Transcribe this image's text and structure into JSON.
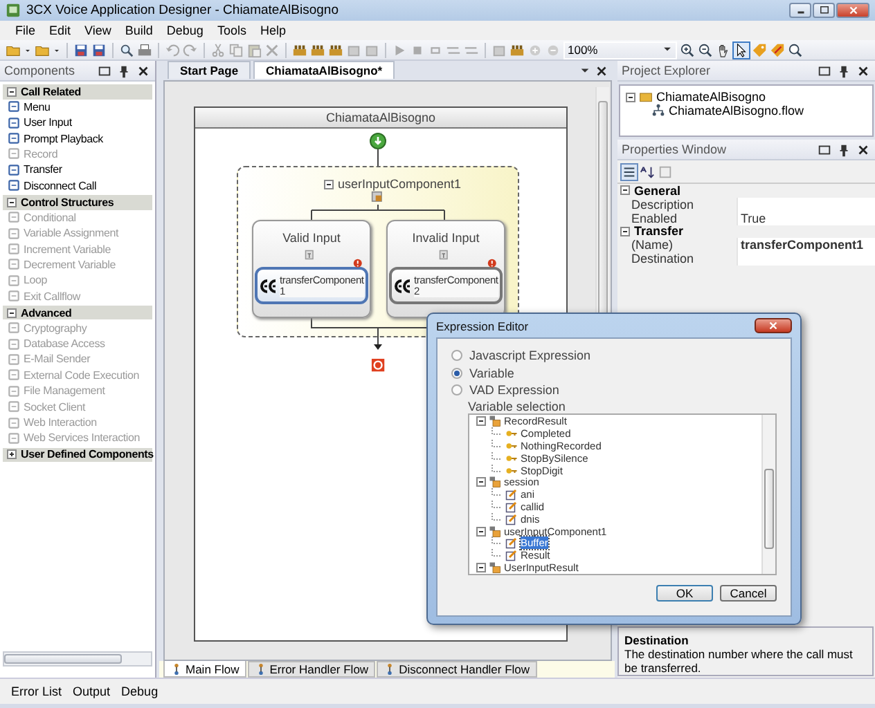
{
  "window": {
    "title": "3CX Voice Application Designer - ChiamateAlBisogno"
  },
  "menu": [
    "File",
    "Edit",
    "View",
    "Build",
    "Debug",
    "Tools",
    "Help"
  ],
  "toolbar": {
    "zoom": "100%"
  },
  "components_panel": {
    "title": "Components",
    "groups": [
      {
        "label": "Call Related",
        "expanded": true,
        "items": [
          {
            "label": "Menu",
            "disabled": false
          },
          {
            "label": "User Input",
            "disabled": false
          },
          {
            "label": "Prompt Playback",
            "disabled": false
          },
          {
            "label": "Record",
            "disabled": true
          },
          {
            "label": "Transfer",
            "disabled": false
          },
          {
            "label": "Disconnect Call",
            "disabled": false
          }
        ]
      },
      {
        "label": "Control Structures",
        "expanded": true,
        "items": [
          {
            "label": "Conditional",
            "disabled": true
          },
          {
            "label": "Variable Assignment",
            "disabled": true
          },
          {
            "label": "Increment Variable",
            "disabled": true
          },
          {
            "label": "Decrement Variable",
            "disabled": true
          },
          {
            "label": "Loop",
            "disabled": true
          },
          {
            "label": "Exit Callflow",
            "disabled": true
          }
        ]
      },
      {
        "label": "Advanced",
        "expanded": true,
        "items": [
          {
            "label": "Cryptography",
            "disabled": true
          },
          {
            "label": "Database Access",
            "disabled": true
          },
          {
            "label": "E-Mail Sender",
            "disabled": true
          },
          {
            "label": "External Code Execution",
            "disabled": true
          },
          {
            "label": "File Management",
            "disabled": true
          },
          {
            "label": "Socket Client",
            "disabled": true
          },
          {
            "label": "Web Interaction",
            "disabled": true
          },
          {
            "label": "Web Services Interaction",
            "disabled": true
          }
        ]
      },
      {
        "label": "User Defined Components",
        "expanded": false
      }
    ]
  },
  "document_tabs": [
    {
      "label": "Start Page",
      "selected": false
    },
    {
      "label": "ChiamataAlBisogno*",
      "selected": true
    }
  ],
  "diagram": {
    "title": "ChiamataAlBisogno",
    "container": {
      "label": "userInputComponent1",
      "expanded": true
    },
    "branches": [
      {
        "label": "Valid Input",
        "component": "transferComponent 1",
        "selected": true
      },
      {
        "label": "Invalid Input",
        "component": "transferComponent 2",
        "selected": false
      }
    ]
  },
  "flow_tabs": [
    {
      "label": "Main Flow",
      "selected": true
    },
    {
      "label": "Error Handler Flow",
      "selected": false
    },
    {
      "label": "Disconnect Handler Flow",
      "selected": false
    }
  ],
  "project_explorer": {
    "title": "Project Explorer",
    "tree": [
      {
        "label": "ChiamateAlBisogno",
        "expanded": true,
        "children": [
          {
            "label": "ChiamateAlBisogno.flow"
          }
        ]
      }
    ]
  },
  "properties": {
    "title": "Properties Window",
    "categories": [
      {
        "label": "General",
        "expanded": true,
        "rows": [
          {
            "name": "Description"
          },
          {
            "name": "Enabled",
            "value": "True"
          }
        ]
      },
      {
        "label": "Transfer",
        "expanded": true,
        "rows": [
          {
            "name": "(Name)",
            "value": "transferComponent1"
          },
          {
            "name": "Destination"
          }
        ]
      }
    ],
    "help": {
      "title": "Destination",
      "text": "The destination number where the call must be transferred."
    }
  },
  "dialog": {
    "title": "Expression Editor",
    "options": [
      {
        "label": "Javascript Expression",
        "selected": false
      },
      {
        "label": "Variable",
        "selected": true
      },
      {
        "label": "VAD Expression",
        "selected": false
      }
    ],
    "group_label": "Variable selection",
    "tree": [
      {
        "label": "RecordResult",
        "kind": "group",
        "expanded": true,
        "selected": false,
        "children": [
          {
            "label": "Completed",
            "kind": "constant",
            "selected": false
          },
          {
            "label": "NothingRecorded",
            "kind": "constant",
            "selected": false
          },
          {
            "label": "StopBySilence",
            "kind": "constant",
            "selected": false
          },
          {
            "label": "StopDigit",
            "kind": "constant",
            "selected": false
          }
        ]
      },
      {
        "label": "session",
        "kind": "group",
        "expanded": true,
        "selected": false,
        "children": [
          {
            "label": "ani",
            "kind": "variable",
            "selected": false
          },
          {
            "label": "callid",
            "kind": "variable",
            "selected": false
          },
          {
            "label": "dnis",
            "kind": "variable",
            "selected": false
          }
        ]
      },
      {
        "label": "userInputComponent1",
        "kind": "group",
        "expanded": true,
        "selected": false,
        "children": [
          {
            "label": "Buffer",
            "kind": "variable",
            "selected": true
          },
          {
            "label": "Result",
            "kind": "variable",
            "selected": false
          }
        ]
      },
      {
        "label": "UserInputResult",
        "kind": "group",
        "expanded": true,
        "selected": false
      }
    ],
    "buttons": [
      "OK",
      "Cancel"
    ]
  },
  "bottom_tabs": [
    "Error List",
    "Output",
    "Debug"
  ]
}
